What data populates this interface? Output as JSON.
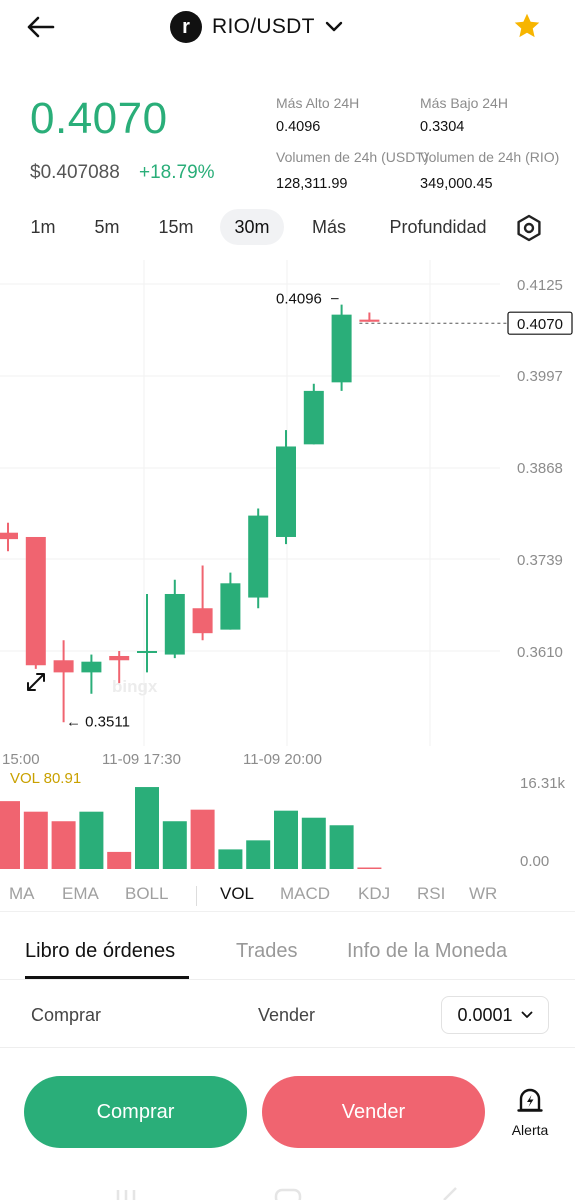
{
  "header": {
    "back_icon": "arrow-left-icon",
    "coin_logo_letter": "r",
    "pair": "RIO/USDT",
    "dropdown_icon": "chevron-down-icon",
    "favorite_icon": "star-icon",
    "favorite_color": "#f7b500"
  },
  "ticker": {
    "last_price": "0.4070",
    "usd_price": "$0.407088",
    "change": "+18.79%",
    "up_color": "#2aae79",
    "down_color": "#f06470",
    "high_label": "Más Alto 24H",
    "high_value": "0.4096",
    "low_label": "Más Bajo 24H",
    "low_value": "0.3304",
    "vol_usdt_label": "Volumen de 24h (USDT)",
    "vol_usdt_value": "128,311.99",
    "vol_rio_label": "Volumen de 24h (RIO)",
    "vol_rio_value": "349,000.45"
  },
  "intervals": {
    "items": [
      "1m",
      "5m",
      "15m",
      "30m",
      "Más",
      "Profundidad"
    ],
    "active": "30m",
    "settings_icon": "settings-hexagon-icon"
  },
  "chart_data": {
    "type": "candlestick",
    "y_ticks": [
      "0.4125",
      "0.3997",
      "0.3868",
      "0.3739",
      "0.3610"
    ],
    "x_ticks": [
      "15:00",
      "11-09 17:30",
      "11-09 20:00"
    ],
    "current_price_label": "0.4070",
    "high_marker": "0.4096",
    "low_marker": "0.3511",
    "candles": [
      {
        "o": 0.3776,
        "h": 0.379,
        "l": 0.375,
        "c": 0.3767
      },
      {
        "o": 0.377,
        "h": 0.377,
        "l": 0.3585,
        "c": 0.359
      },
      {
        "o": 0.3597,
        "h": 0.3625,
        "l": 0.351,
        "c": 0.358
      },
      {
        "o": 0.358,
        "h": 0.3605,
        "l": 0.355,
        "c": 0.3595
      },
      {
        "o": 0.3603,
        "h": 0.361,
        "l": 0.3565,
        "c": 0.3597
      },
      {
        "o": 0.361,
        "h": 0.369,
        "l": 0.358,
        "c": 0.361
      },
      {
        "o": 0.3605,
        "h": 0.371,
        "l": 0.36,
        "c": 0.369
      },
      {
        "o": 0.367,
        "h": 0.373,
        "l": 0.3625,
        "c": 0.3635
      },
      {
        "o": 0.364,
        "h": 0.372,
        "l": 0.364,
        "c": 0.3705
      },
      {
        "o": 0.3685,
        "h": 0.381,
        "l": 0.367,
        "c": 0.38
      },
      {
        "o": 0.377,
        "h": 0.392,
        "l": 0.376,
        "c": 0.3897
      },
      {
        "o": 0.39,
        "h": 0.3985,
        "l": 0.39,
        "c": 0.3975
      },
      {
        "o": 0.3987,
        "h": 0.4096,
        "l": 0.3975,
        "c": 0.4082
      },
      {
        "o": 0.4075,
        "h": 0.4085,
        "l": 0.4072,
        "c": 0.4072
      }
    ],
    "volume_label": "VOL 80.91",
    "volume_ticks": [
      "16.31k",
      "0.00"
    ],
    "volume_max": 16310,
    "volumes": [
      13500,
      11400,
      9500,
      11400,
      3400,
      16300,
      9500,
      11800,
      3900,
      5700,
      11600,
      10200,
      8700,
      100
    ],
    "volume_label_color": "#c9a100",
    "watermark": "bingx"
  },
  "indicators": {
    "items": [
      "MA",
      "EMA",
      "BOLL",
      "VOL",
      "MACD",
      "KDJ",
      "RSI",
      "WR"
    ],
    "active": "VOL"
  },
  "book_tabs": {
    "items": [
      "Libro de órdenes",
      "Trades",
      "Info de la Moneda"
    ],
    "active": "Libro de órdenes"
  },
  "book_header": {
    "buy_label": "Comprar",
    "sell_label": "Vender",
    "precision": "0.0001"
  },
  "actions": {
    "buy": "Comprar",
    "sell": "Vender",
    "alert": "Alerta",
    "alert_icon": "bell-lightning-icon"
  }
}
